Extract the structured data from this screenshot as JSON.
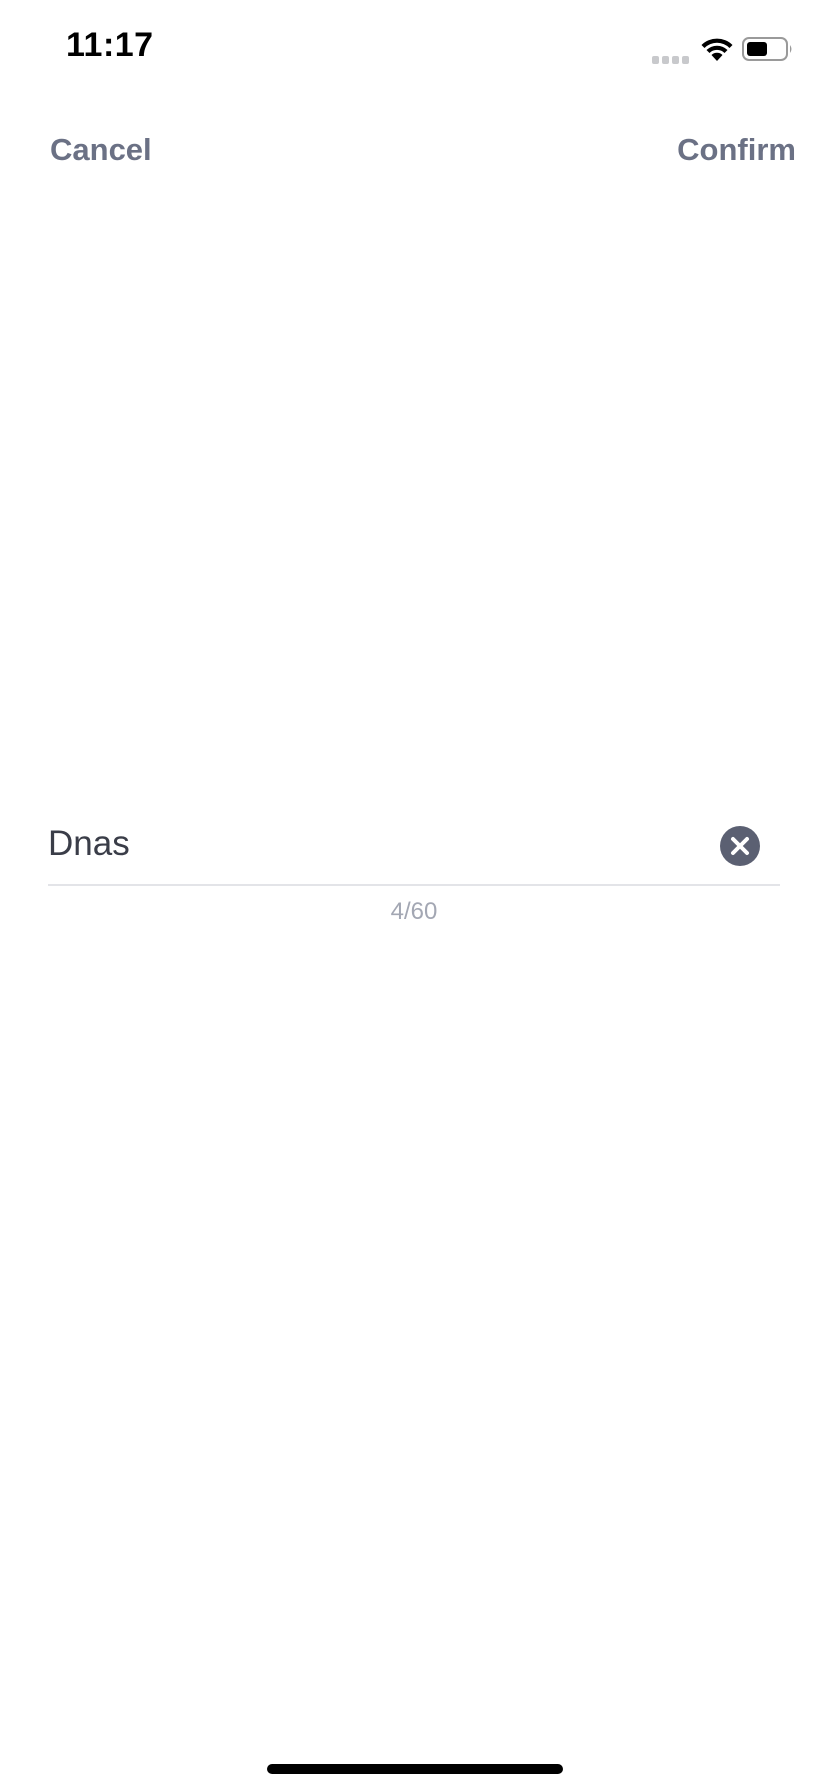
{
  "status_bar": {
    "time": "11:17",
    "signal_icon": "signal-icon",
    "wifi_icon": "wifi-icon",
    "battery_icon": "battery-icon"
  },
  "nav": {
    "cancel_label": "Cancel",
    "confirm_label": "Confirm"
  },
  "form": {
    "name_value": "Dnas",
    "clear_icon": "close-circle-icon",
    "counter": "4/60"
  },
  "colors": {
    "nav_text": "#6b7185",
    "input_text": "#3a3d48",
    "clear_button": "#5b6072",
    "counter_text": "#a3a7b3",
    "divider": "#e3e4e8"
  }
}
